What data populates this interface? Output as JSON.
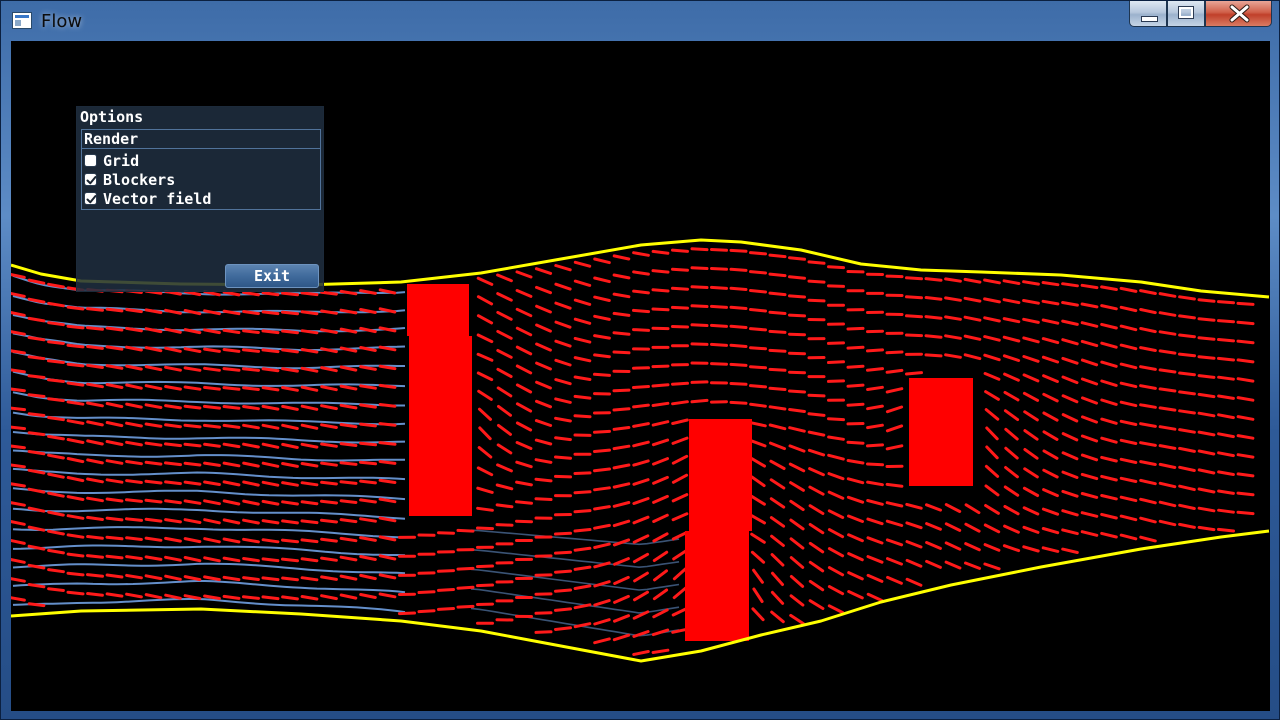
{
  "window": {
    "title": "Flow",
    "buttons": {
      "minimize": "minimize-icon",
      "maximize": "maximize-icon",
      "close": "close-icon"
    }
  },
  "options_panel": {
    "title": "Options",
    "group_label": "Render",
    "options": [
      {
        "label": "Grid",
        "checked": false
      },
      {
        "label": "Blockers",
        "checked": true
      },
      {
        "label": "Vector field",
        "checked": true
      }
    ],
    "exit_label": "Exit"
  },
  "scene": {
    "colors": {
      "background": "#000000",
      "boundary": "#ffff00",
      "blocker": "#ff0000",
      "vector": "#ff1a1a",
      "streamline": "#6f9ee0"
    }
  }
}
